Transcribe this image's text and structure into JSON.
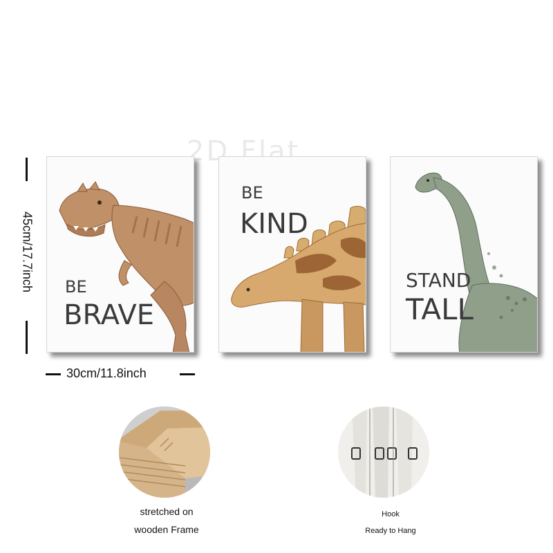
{
  "watermark": "2D Flat",
  "panels": [
    {
      "line1": "BE",
      "line2": "BRAVE"
    },
    {
      "line1": "BE",
      "line2": "KIND"
    },
    {
      "line1": "STAND",
      "line2": "TALL"
    }
  ],
  "dimensions": {
    "height_label": "45cm/17.7inch",
    "width_label": "30cm/11.8inch"
  },
  "features": {
    "frame": {
      "line1": "stretched on",
      "line2": "wooden Frame"
    },
    "hook": {
      "line1": "Hook",
      "line2": "Ready to Hang"
    }
  },
  "colors": {
    "trex": "#b98a63",
    "stego": "#c08040",
    "brachio": "#7f8f7c",
    "wood": "#d6b48a"
  }
}
